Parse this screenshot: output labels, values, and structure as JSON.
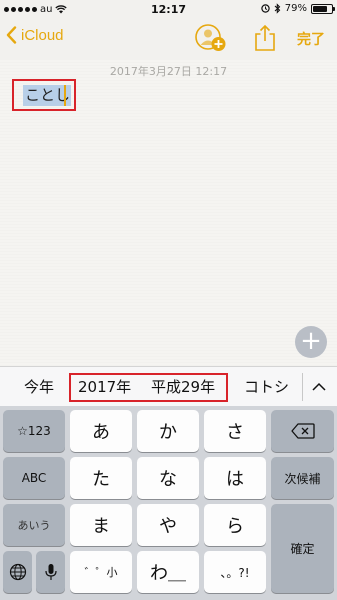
{
  "status": {
    "carrier": "au",
    "time": "12:17",
    "battery": "79%",
    "battery_level": 0.79
  },
  "nav": {
    "back_label": "iCloud",
    "done_label": "完了"
  },
  "note": {
    "date": "2017年3月27日 12:17",
    "text": "ことし"
  },
  "candidates": [
    "今年",
    "2017年",
    "平成29年",
    "コトシ"
  ],
  "keyboard": {
    "left_column": [
      "☆123",
      "ABC",
      "あいう"
    ],
    "rows": [
      [
        "あ",
        "か",
        "さ"
      ],
      [
        "た",
        "な",
        "は"
      ],
      [
        "ま",
        "や",
        "ら"
      ],
      [
        "゛゜小",
        "わ＿",
        "、。?!"
      ]
    ],
    "next_candidate": "次候補",
    "confirm": "確定"
  }
}
